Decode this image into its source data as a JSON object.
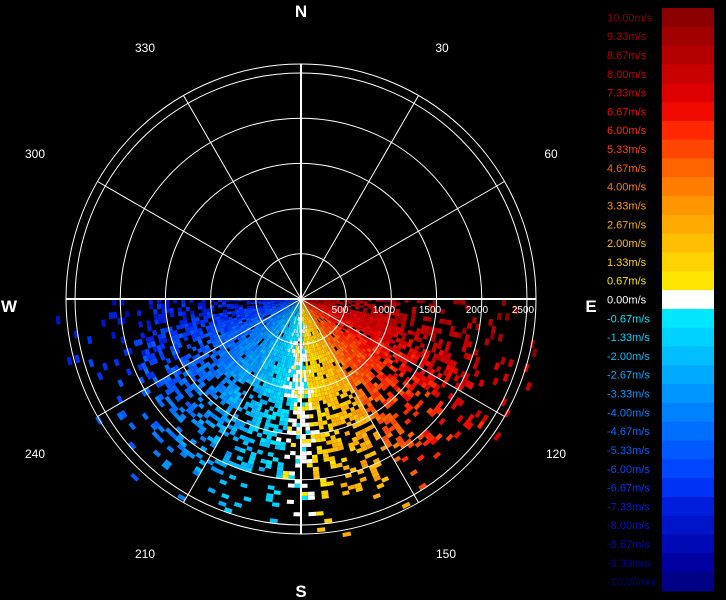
{
  "chart_data": {
    "type": "polar-velocity-ppi",
    "unit": "m/s",
    "cardinals": [
      "N",
      "E",
      "S",
      "W"
    ],
    "bearing_labels": [
      "30",
      "60",
      "120",
      "150",
      "210",
      "240",
      "300",
      "330"
    ],
    "range_labels": [
      "500",
      "1000",
      "1500",
      "2000",
      "2500"
    ],
    "ring_ranges": [
      500,
      1000,
      1500,
      2000,
      2500
    ],
    "max_range": 2600,
    "colorbar": [
      {
        "label": "10.00m/s",
        "value": 10.0,
        "color": "#8c0000"
      },
      {
        "label": "9.33m/s",
        "value": 9.33,
        "color": "#a00000"
      },
      {
        "label": "8.67m/s",
        "value": 8.67,
        "color": "#b40000"
      },
      {
        "label": "8.00m/s",
        "value": 8.0,
        "color": "#c80000"
      },
      {
        "label": "7.33m/s",
        "value": 7.33,
        "color": "#dc0000"
      },
      {
        "label": "6.67m/s",
        "value": 6.67,
        "color": "#f00a00"
      },
      {
        "label": "6.00m/s",
        "value": 6.0,
        "color": "#ff2800"
      },
      {
        "label": "5.33m/s",
        "value": 5.33,
        "color": "#ff4600"
      },
      {
        "label": "4.67m/s",
        "value": 4.67,
        "color": "#ff6400"
      },
      {
        "label": "4.00m/s",
        "value": 4.0,
        "color": "#ff7d00"
      },
      {
        "label": "3.33m/s",
        "value": 3.33,
        "color": "#ff9600"
      },
      {
        "label": "2.67m/s",
        "value": 2.67,
        "color": "#ffaa00"
      },
      {
        "label": "2.00m/s",
        "value": 2.0,
        "color": "#ffbe00"
      },
      {
        "label": "1.33m/s",
        "value": 1.33,
        "color": "#ffd200"
      },
      {
        "label": "0.67m/s",
        "value": 0.67,
        "color": "#ffe600"
      },
      {
        "label": "0.00m/s",
        "value": 0.0,
        "color": "#ffffff"
      },
      {
        "label": "-0.67m/s",
        "value": -0.67,
        "color": "#00e6ff"
      },
      {
        "label": "-1.33m/s",
        "value": -1.33,
        "color": "#00d2ff"
      },
      {
        "label": "-2.00m/s",
        "value": -2.0,
        "color": "#00beff"
      },
      {
        "label": "-2.67m/s",
        "value": -2.67,
        "color": "#00aaff"
      },
      {
        "label": "-3.33m/s",
        "value": -3.33,
        "color": "#0096ff"
      },
      {
        "label": "-4.00m/s",
        "value": -4.0,
        "color": "#0082ff"
      },
      {
        "label": "-4.67m/s",
        "value": -4.67,
        "color": "#006eff"
      },
      {
        "label": "-5.33m/s",
        "value": -5.33,
        "color": "#005aff"
      },
      {
        "label": "-6.00m/s",
        "value": -6.0,
        "color": "#0046ff"
      },
      {
        "label": "-6.67m/s",
        "value": -6.67,
        "color": "#0032f5"
      },
      {
        "label": "-7.33m/s",
        "value": -7.33,
        "color": "#001edc"
      },
      {
        "label": "-8.00m/s",
        "value": -8.0,
        "color": "#0014c8"
      },
      {
        "label": "-8.67m/s",
        "value": -8.67,
        "color": "#000ab4"
      },
      {
        "label": "-9.33m/s",
        "value": -9.33,
        "color": "#0000a0"
      },
      {
        "label": "-10.00m/s",
        "value": -10.0,
        "color": "#000087"
      }
    ],
    "sector": {
      "azimuth_range_deg": [
        90,
        270
      ],
      "velocity_pattern": "approx. -6 m/s toward west (220-270 deg), near 0 m/s at south, +3 to +8 m/s toward east (90-150 deg)",
      "dense_coverage_range": [
        0,
        1100
      ],
      "sparse_coverage_range": [
        1100,
        2700
      ]
    },
    "grid": true
  }
}
